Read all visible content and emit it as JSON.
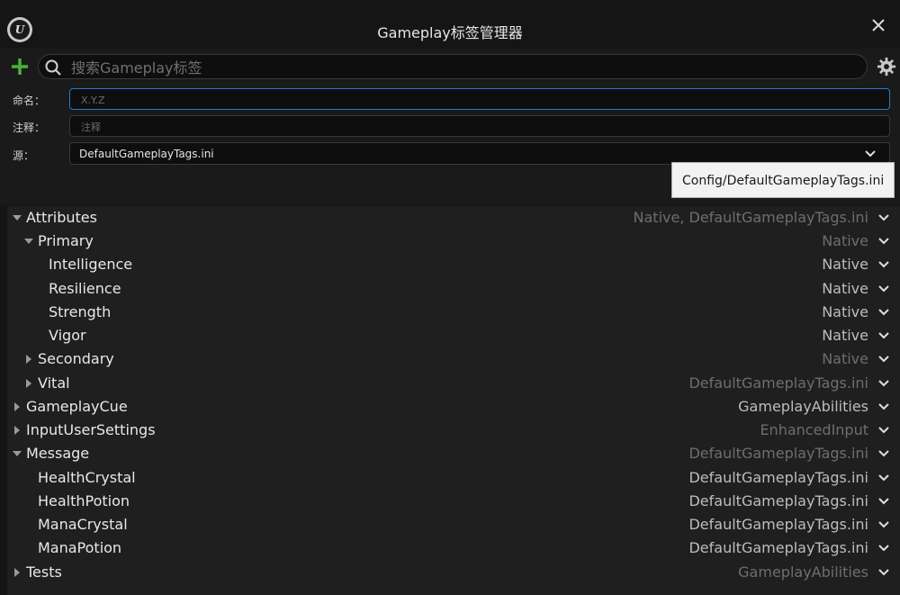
{
  "window": {
    "title": "Gameplay标签管理器"
  },
  "toolbar": {
    "search_placeholder": "搜索Gameplay标签",
    "search_value": ""
  },
  "form": {
    "name_label": "命名：",
    "name_placeholder": "X.Y.Z",
    "comment_label": "注释：",
    "comment_placeholder": "注释",
    "source_label": "源：",
    "source_value": "DefaultGameplayTags.ini"
  },
  "dropdown": {
    "option": "Config/DefaultGameplayTags.ini"
  },
  "colors": {
    "accent_green": "#4caf3a",
    "focus_blue": "#2a79c9"
  },
  "tree": [
    {
      "name": "Attributes",
      "source": "Native, DefaultGameplayTags.ini",
      "depth": 0,
      "state": "expanded",
      "source_dim": true
    },
    {
      "name": "Primary",
      "source": "Native",
      "depth": 1,
      "state": "expanded",
      "source_dim": true
    },
    {
      "name": "Intelligence",
      "source": "Native",
      "depth": 2,
      "state": "leaf",
      "source_dim": false
    },
    {
      "name": "Resilience",
      "source": "Native",
      "depth": 2,
      "state": "leaf",
      "source_dim": false
    },
    {
      "name": "Strength",
      "source": "Native",
      "depth": 2,
      "state": "leaf",
      "source_dim": false
    },
    {
      "name": "Vigor",
      "source": "Native",
      "depth": 2,
      "state": "leaf",
      "source_dim": false
    },
    {
      "name": "Secondary",
      "source": "Native",
      "depth": 1,
      "state": "collapsed",
      "source_dim": true
    },
    {
      "name": "Vital",
      "source": "DefaultGameplayTags.ini",
      "depth": 1,
      "state": "collapsed",
      "source_dim": true
    },
    {
      "name": "GameplayCue",
      "source": "GameplayAbilities",
      "depth": 0,
      "state": "collapsed",
      "source_dim": false
    },
    {
      "name": "InputUserSettings",
      "source": "EnhancedInput",
      "depth": 0,
      "state": "collapsed",
      "source_dim": true
    },
    {
      "name": "Message",
      "source": "DefaultGameplayTags.ini",
      "depth": 0,
      "state": "expanded",
      "source_dim": true
    },
    {
      "name": "HealthCrystal",
      "source": "DefaultGameplayTags.ini",
      "depth": 1,
      "state": "leaf",
      "source_dim": false
    },
    {
      "name": "HealthPotion",
      "source": "DefaultGameplayTags.ini",
      "depth": 1,
      "state": "leaf",
      "source_dim": false
    },
    {
      "name": "ManaCrystal",
      "source": "DefaultGameplayTags.ini",
      "depth": 1,
      "state": "leaf",
      "source_dim": false
    },
    {
      "name": "ManaPotion",
      "source": "DefaultGameplayTags.ini",
      "depth": 1,
      "state": "leaf",
      "source_dim": false
    },
    {
      "name": "Tests",
      "source": "GameplayAbilities",
      "depth": 0,
      "state": "collapsed",
      "source_dim": true
    }
  ]
}
